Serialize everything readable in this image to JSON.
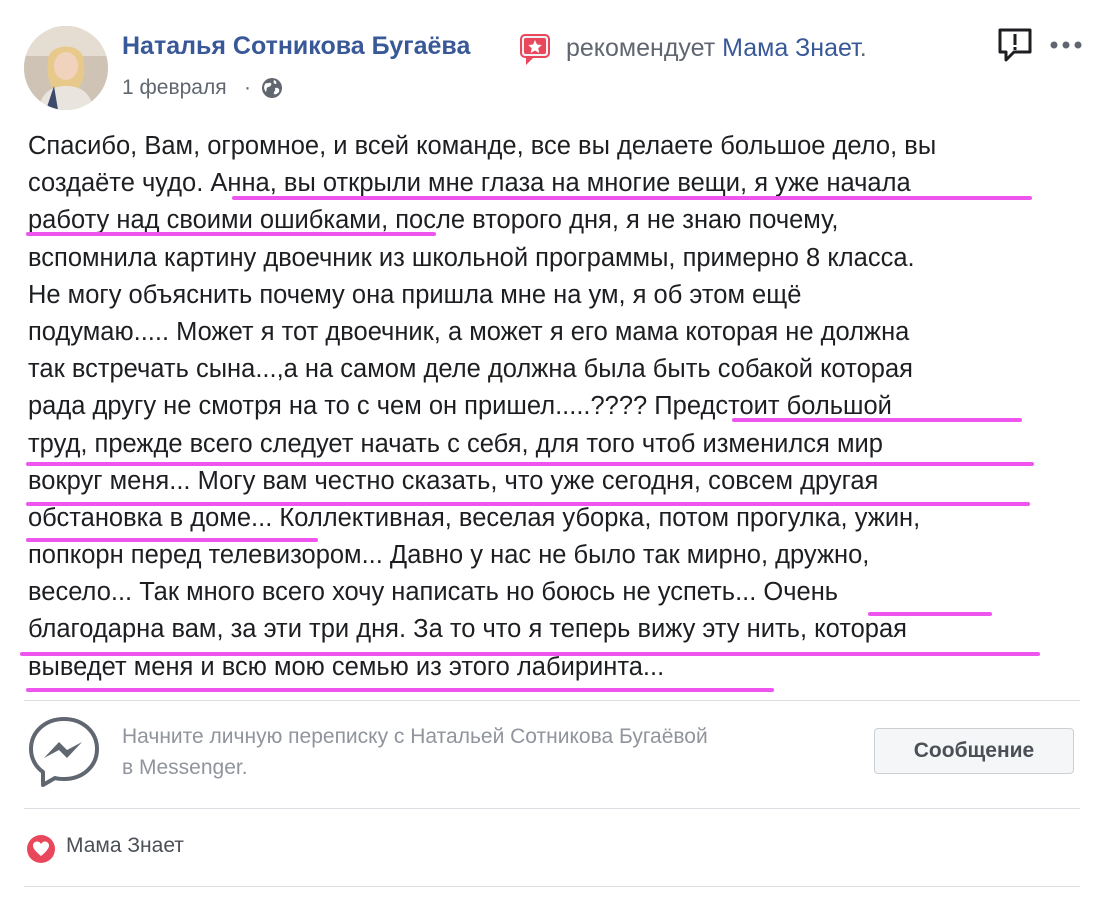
{
  "post": {
    "author_name": "Наталья Сотникова Бугаёва",
    "recommends_text": "рекомендует",
    "page_name": "Мама Знает",
    "date": "1 февраля",
    "separator": "·",
    "privacy_icon": "globe-icon",
    "report_icon": "report-icon",
    "more_label": "...",
    "badge_icon": "recommendation-star-icon"
  },
  "body_lines": [
    "Спасибо, Вам, огромное, и всей команде, все вы делаете большое дело, вы",
    "создаёте чудо. Анна, вы открыли мне глаза на многие вещи, я уже начала",
    "работу над своими ошибками, после второго дня, я не знаю почему,",
    "вспомнила картину двоечник из школьной программы, примерно 8 класса.",
    "Не могу объяснить почему она пришла мне на ум, я об этом ещё",
    "подумаю..... Может я тот двоечник, а может я его мама которая не должна",
    "так встречать сына...,а на самом деле должна была быть собакой которая",
    "рада другу не смотря на то с чем он пришел.....???? Предстоит большой",
    "труд, прежде всего следует начать с себя, для того чтоб изменился мир",
    "вокруг меня... Могу вам честно сказать, что уже сегодня, совсем другая",
    "обстановка в доме... Коллективная, веселая уборка, потом прогулка, ужин,",
    "попкорн перед телевизором... Давно у нас не было так мирно, дружно,",
    "весело... Так много всего хочу написать но боюсь не успеть... Очень",
    "благодарна вам, за эти три дня. За то что я теперь вижу эту нить, которая",
    "выведет меня и всю мою семью из этого лабиринта..."
  ],
  "highlight_color": "#ee55ee",
  "messenger": {
    "icon": "messenger-icon",
    "prompt_line1": "Начните личную переписку с Натальей Сотникова Бугаёвой",
    "prompt_line2": "в Messenger.",
    "button_label": "Сообщение"
  },
  "footer": {
    "heart_icon": "heart-icon",
    "liked_page": "Мама Знает",
    "heart_color": "#e9475c"
  },
  "colors": {
    "link": "#385898",
    "secondary_text": "#616770",
    "muted_text": "#90949c"
  }
}
